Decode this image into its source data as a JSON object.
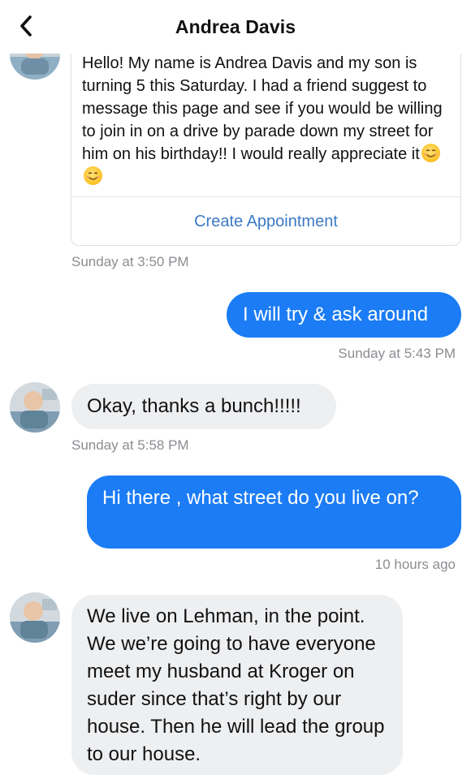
{
  "header": {
    "title": "Andrea Davis",
    "back_icon": "chevron-left-icon"
  },
  "messages": {
    "card": {
      "text": "Hello! My name is Andrea Davis and my son is turning 5 this Saturday. I had a friend suggest to message this page and see if you would be willing to join in on a drive by parade down my street for him on his birthday!! I would really appreciate it",
      "emoji": [
        "smiling-face-emoji",
        "smiling-face-emoji"
      ],
      "action_label": "Create Appointment",
      "timestamp": "Sunday at 3:50 PM"
    },
    "m1": {
      "direction": "outgoing",
      "text": "I will try & ask around",
      "timestamp": "Sunday at 5:43 PM"
    },
    "m2": {
      "direction": "incoming",
      "text": "Okay, thanks a bunch!!!!!",
      "timestamp": "Sunday at 5:58 PM"
    },
    "m3": {
      "direction": "outgoing",
      "text": "Hi there , what street do you live on?",
      "timestamp": "10 hours ago"
    },
    "m4": {
      "direction": "incoming",
      "text": "We live on Lehman, in the point. We we’re going to have everyone meet my husband at Kroger on suder since that’s right by our house. Then he will lead the group to our house."
    }
  },
  "colors": {
    "outgoing_bubble": "#1b7cf5",
    "incoming_bubble": "#eeeff1",
    "link": "#3b79c6",
    "timestamp": "#8a8d91"
  }
}
